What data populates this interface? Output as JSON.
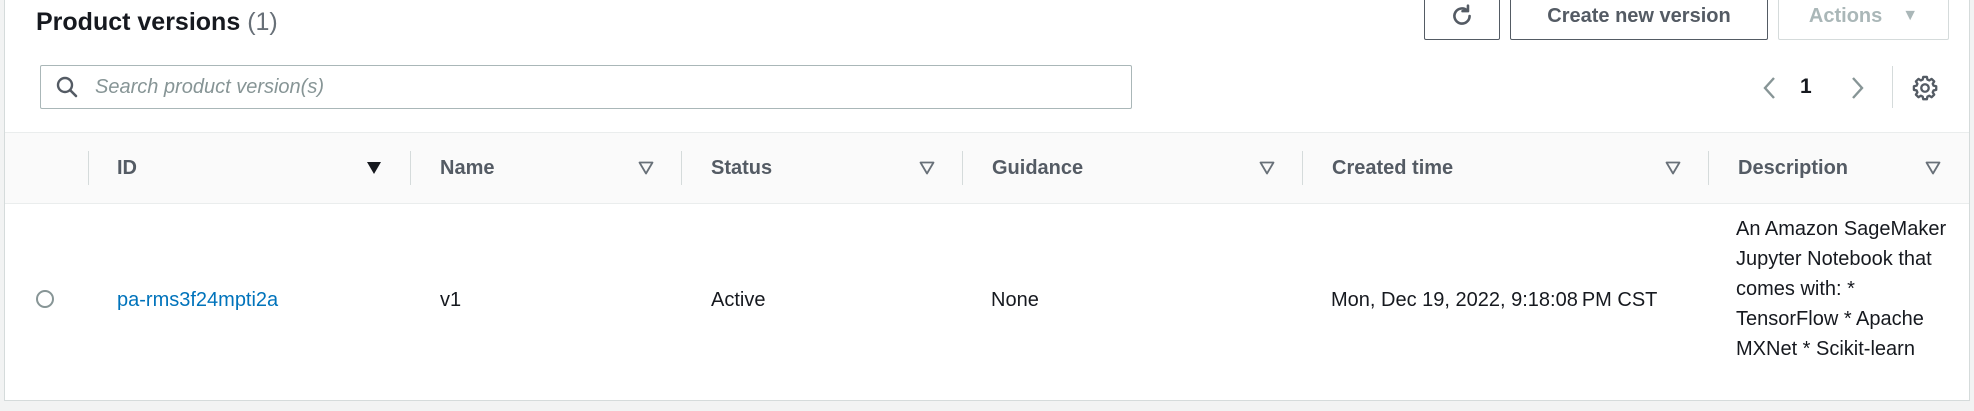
{
  "header": {
    "title": "Product versions",
    "count": "(1)"
  },
  "toolbar": {
    "refresh_icon": "refresh-icon",
    "create_label": "Create new version",
    "actions_label": "Actions"
  },
  "search": {
    "placeholder": "Search product version(s)",
    "value": ""
  },
  "pagination": {
    "current_page": "1"
  },
  "table": {
    "columns": [
      "ID",
      "Name",
      "Status",
      "Guidance",
      "Created time",
      "Description"
    ],
    "rows": [
      {
        "id": "pa-rms3f24mpti2a",
        "name": "v1",
        "status": "Active",
        "guidance": "None",
        "created_time": "Mon, Dec 19, 2022, 9:18:08 PM CST",
        "description": "An Amazon SageMaker Jupyter Notebook that comes with: * TensorFlow * Apache MXNet * Scikit-learn"
      }
    ]
  },
  "colors": {
    "link": "#0073bb",
    "border": "#d5dbdb",
    "header_bg": "#fafafa"
  }
}
